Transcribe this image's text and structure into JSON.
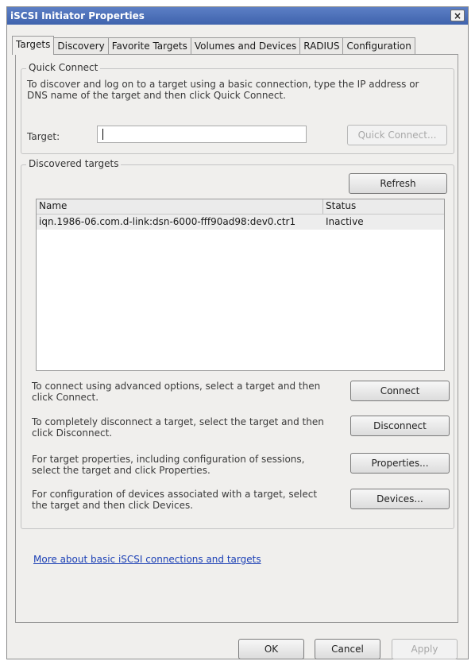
{
  "window": {
    "title": "iSCSI Initiator Properties",
    "close_glyph": "×"
  },
  "tabs": [
    {
      "label": "Targets",
      "active": true
    },
    {
      "label": "Discovery",
      "active": false
    },
    {
      "label": "Favorite Targets",
      "active": false
    },
    {
      "label": "Volumes and Devices",
      "active": false
    },
    {
      "label": "RADIUS",
      "active": false
    },
    {
      "label": "Configuration",
      "active": false
    }
  ],
  "quick_connect": {
    "group_label": "Quick Connect",
    "description": "To discover and log on to a target using a basic connection, type the IP address or DNS name of the target and then click Quick Connect.",
    "target_label": "Target:",
    "target_value": "",
    "button_label": "Quick Connect..."
  },
  "discovered": {
    "group_label": "Discovered targets",
    "refresh_label": "Refresh",
    "columns": [
      "Name",
      "Status"
    ],
    "rows": [
      {
        "name": "iqn.1986-06.com.d-link:dsn-6000-fff90ad98:dev0.ctr1",
        "status": "Inactive"
      }
    ]
  },
  "actions": [
    {
      "text": "To connect using advanced options, select a target and then click Connect.",
      "button": "Connect"
    },
    {
      "text": "To completely disconnect a target, select the target and then click Disconnect.",
      "button": "Disconnect"
    },
    {
      "text": "For target properties, including configuration of sessions, select the target and click Properties.",
      "button": "Properties..."
    },
    {
      "text": "For configuration of devices associated with a target, select the target and then click Devices.",
      "button": "Devices..."
    }
  ],
  "help_link": "More about basic iSCSI connections and targets",
  "footer": {
    "ok": "OK",
    "cancel": "Cancel",
    "apply": "Apply"
  },
  "colors": {
    "title_bar": "#3f63ad",
    "link": "#1a3fb5",
    "window_bg": "#f0efed"
  },
  "icons": {
    "close": "close-icon"
  }
}
